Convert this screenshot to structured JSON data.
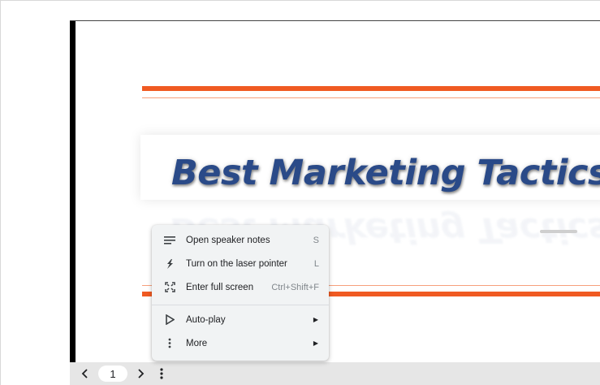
{
  "slide": {
    "title": "Best Marketing Tactics",
    "accent_color": "#f05a22",
    "title_color": "#2a4a88"
  },
  "menu": {
    "items": [
      {
        "label": "Open speaker notes",
        "shortcut": "S",
        "icon": "speaker-notes-icon"
      },
      {
        "label": "Turn on the laser pointer",
        "shortcut": "L",
        "icon": "laser-pointer-icon"
      },
      {
        "label": "Enter full screen",
        "shortcut": "Ctrl+Shift+F",
        "icon": "fullscreen-icon"
      },
      {
        "label": "Auto-play",
        "icon": "play-icon",
        "submenu": true
      },
      {
        "label": "More",
        "icon": "more-vertical-icon",
        "submenu": true
      }
    ]
  },
  "toolbar": {
    "page_number": "1",
    "prev_icon": "chevron-left-icon",
    "next_icon": "chevron-right-icon",
    "options_icon": "more-vertical-icon"
  }
}
